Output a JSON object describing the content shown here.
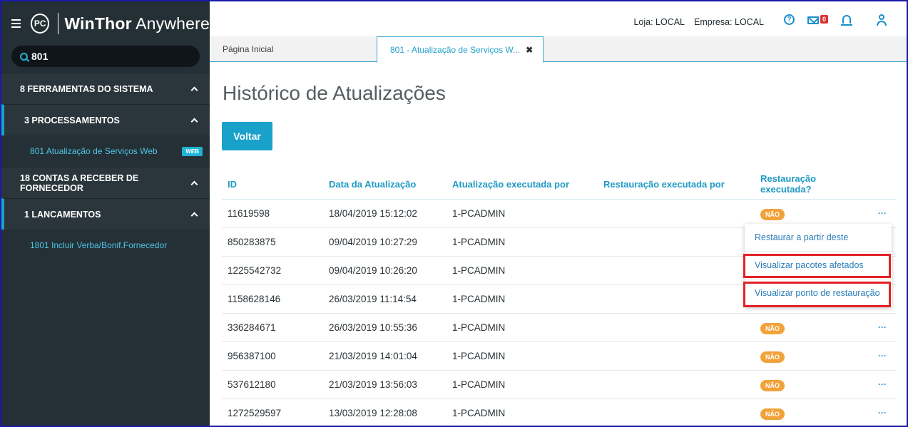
{
  "brand": {
    "logo": "PC",
    "name_bold": "WinThor",
    "name_rest": " Anywhere"
  },
  "search": {
    "value": "801"
  },
  "menu": [
    {
      "kind": "group",
      "label": "8  FERRAMENTAS DO SISTEMA"
    },
    {
      "kind": "subgroup",
      "label": "3  PROCESSAMENTOS"
    },
    {
      "kind": "item",
      "label": "801  Atualização de Serviços Web",
      "badge": "WEB"
    },
    {
      "kind": "group",
      "label": "18  CONTAS A RECEBER DE FORNECEDOR"
    },
    {
      "kind": "subgroup",
      "label": "1  LANCAMENTOS"
    },
    {
      "kind": "item",
      "label": "1801  Incluir Verba/Bonif.Fornecedor"
    }
  ],
  "topbar": {
    "loja": "Loja: LOCAL",
    "empresa": "Empresa: LOCAL",
    "mail_count": "0"
  },
  "tabs": {
    "home": "Página Inicial",
    "active": "801 - Atualização de Serviços W...",
    "close": "✖"
  },
  "page": {
    "title": "Histórico de Atualizações",
    "back_button": "Voltar"
  },
  "table": {
    "headers": [
      "ID",
      "Data da Atualização",
      "Atualização executada por",
      "Restauração executada por",
      "Restauração executada?"
    ],
    "rows": [
      {
        "id": "11619598",
        "date": "18/04/2019 15:12:02",
        "by": "1-PCADMIN",
        "restored_by": "",
        "restored": "NÃO"
      },
      {
        "id": "850283875",
        "date": "09/04/2019 10:27:29",
        "by": "1-PCADMIN",
        "restored_by": "",
        "restored": ""
      },
      {
        "id": "1225542732",
        "date": "09/04/2019 10:26:20",
        "by": "1-PCADMIN",
        "restored_by": "",
        "restored": ""
      },
      {
        "id": "1158628146",
        "date": "26/03/2019 11:14:54",
        "by": "1-PCADMIN",
        "restored_by": "",
        "restored": ""
      },
      {
        "id": "336284671",
        "date": "26/03/2019 10:55:36",
        "by": "1-PCADMIN",
        "restored_by": "",
        "restored": "NÃO"
      },
      {
        "id": "956387100",
        "date": "21/03/2019 14:01:04",
        "by": "1-PCADMIN",
        "restored_by": "",
        "restored": "NÃO"
      },
      {
        "id": "537612180",
        "date": "21/03/2019 13:56:03",
        "by": "1-PCADMIN",
        "restored_by": "",
        "restored": "NÃO"
      },
      {
        "id": "1272529597",
        "date": "13/03/2019 12:28:08",
        "by": "1-PCADMIN",
        "restored_by": "",
        "restored": "NÃO"
      }
    ],
    "row_action": "···"
  },
  "dropdown": {
    "items": [
      "Restaurar a partir deste",
      "Visualizar pacotes afetados",
      "Visualizar ponto de restauração"
    ]
  },
  "colors": {
    "sidebar": "#253036",
    "accent": "#1aa1c9",
    "badge": "#f2a23a",
    "highlight": "#e32226"
  }
}
